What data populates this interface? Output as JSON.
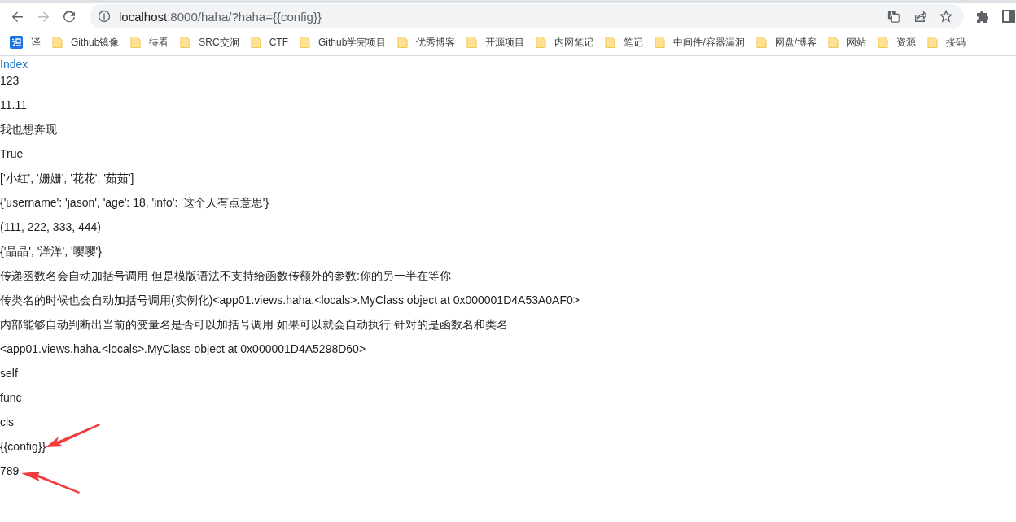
{
  "toolbar": {
    "back": {
      "disabled": false
    },
    "forward": {
      "disabled": true
    },
    "url": "localhost:8000/haha/?haha={{config}}"
  },
  "bookmarks": [
    {
      "kind": "app",
      "label": "译"
    },
    {
      "kind": "folder",
      "label": "Github镜像"
    },
    {
      "kind": "folder",
      "label": "待看"
    },
    {
      "kind": "folder",
      "label": "SRC交洞"
    },
    {
      "kind": "folder",
      "label": "CTF"
    },
    {
      "kind": "folder",
      "label": "Github学完项目"
    },
    {
      "kind": "folder",
      "label": "优秀博客"
    },
    {
      "kind": "folder",
      "label": "开源项目"
    },
    {
      "kind": "folder",
      "label": "内网笔记"
    },
    {
      "kind": "folder",
      "label": "笔记"
    },
    {
      "kind": "folder",
      "label": "中间件/容器漏洞"
    },
    {
      "kind": "folder",
      "label": "网盘/博客"
    },
    {
      "kind": "folder",
      "label": "网站"
    },
    {
      "kind": "folder",
      "label": "资源"
    },
    {
      "kind": "folder",
      "label": "接码"
    }
  ],
  "page": [
    {
      "kind": "link",
      "text": "Index"
    },
    {
      "kind": "text",
      "text": "123"
    },
    {
      "kind": "text",
      "text": "11.11"
    },
    {
      "kind": "text",
      "text": "我也想奔现"
    },
    {
      "kind": "text",
      "text": "True"
    },
    {
      "kind": "text",
      "text": "['小红', '姗姗', '花花', '茹茹']"
    },
    {
      "kind": "text",
      "text": "{'username': 'jason', 'age': 18, 'info': '这个人有点意思'}"
    },
    {
      "kind": "text",
      "text": "(111, 222, 333, 444)"
    },
    {
      "kind": "text",
      "text": "{'晶晶', '洋洋', '嘤嘤'}"
    },
    {
      "kind": "text",
      "text": "传递函数名会自动加括号调用 但是模版语法不支持给函数传额外的参数:你的另一半在等你"
    },
    {
      "kind": "text",
      "text": "传类名的时候也会自动加括号调用(实例化)<app01.views.haha.<locals>.MyClass object at 0x000001D4A53A0AF0>"
    },
    {
      "kind": "text",
      "text": "内部能够自动判断出当前的变量名是否可以加括号调用 如果可以就会自动执行 针对的是函数名和类名"
    },
    {
      "kind": "text",
      "text": "<app01.views.haha.<locals>.MyClass object at 0x000001D4A5298D60>"
    },
    {
      "kind": "text",
      "text": "self"
    },
    {
      "kind": "text",
      "text": "func"
    },
    {
      "kind": "text",
      "text": "cls"
    },
    {
      "kind": "text",
      "text": "{{config}}"
    },
    {
      "kind": "text",
      "text": "789"
    }
  ]
}
